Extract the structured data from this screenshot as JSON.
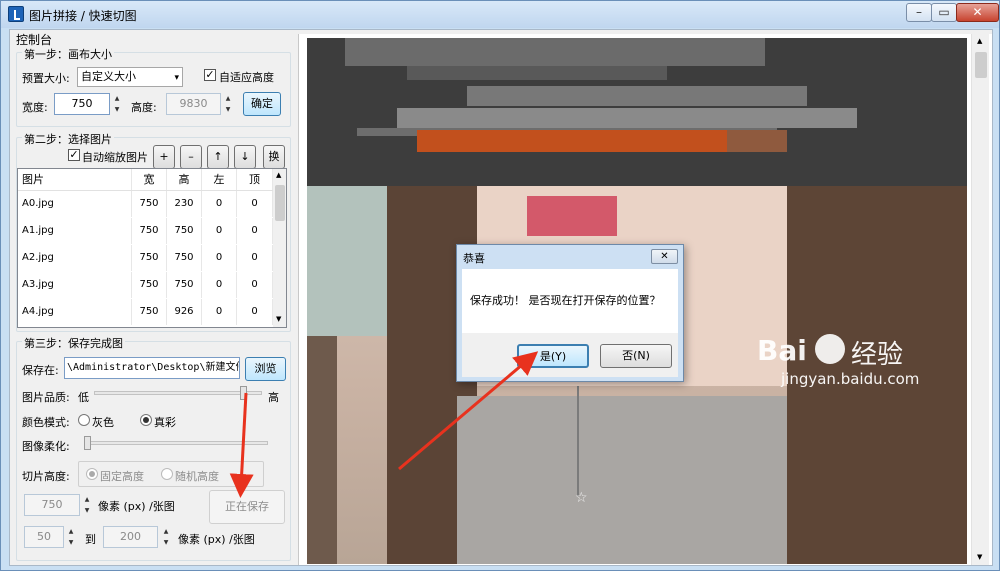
{
  "window": {
    "title": "图片拼接 / 快速切图",
    "min": "–",
    "max": "▭",
    "close": "✕"
  },
  "console_label": "控制台",
  "step1": {
    "title": "第一步：画布大小",
    "preset_label": "预置大小:",
    "preset_value": "自定义大小",
    "adapt_height_label": "自适应高度",
    "adapt_height_checked": true,
    "width_label": "宽度:",
    "width_value": "750",
    "height_label": "高度:",
    "height_value": "9830",
    "confirm": "确定"
  },
  "step2": {
    "title": "第二步：选择图片",
    "auto_scale_label": "自动缩放图片",
    "auto_scale_checked": true,
    "buttons": {
      "add": "+",
      "remove": "–",
      "up": "↑",
      "down": "↓",
      "swap": "换"
    },
    "columns": [
      "图片",
      "宽",
      "高",
      "左",
      "顶"
    ],
    "rows": [
      [
        "A0.jpg",
        "750",
        "230",
        "0",
        "0"
      ],
      [
        "A1.jpg",
        "750",
        "750",
        "0",
        "0"
      ],
      [
        "A2.jpg",
        "750",
        "750",
        "0",
        "0"
      ],
      [
        "A3.jpg",
        "750",
        "750",
        "0",
        "0"
      ],
      [
        "A4.jpg",
        "750",
        "926",
        "0",
        "0"
      ]
    ]
  },
  "step3": {
    "title": "第三步：保存完成图",
    "save_label": "保存在:",
    "save_path": "\\Administrator\\Desktop\\新建文件夹",
    "browse": "浏览",
    "quality_label": "图片品质:",
    "quality_low": "低",
    "quality_high": "高",
    "quality_level": 0.9,
    "color_label": "颜色模式:",
    "color_gray": "灰色",
    "color_true": "真彩",
    "color_selected": "真彩",
    "soften_label": "图像柔化:",
    "soften_level": 0.0,
    "slice_label": "切片高度:",
    "slice_fixed": "固定高度",
    "slice_random": "随机高度",
    "px_value": "750",
    "px_unit": "像素 (px) /张图",
    "saving": "正在保存",
    "range_from": "50",
    "range_to_label": "到",
    "range_to": "200",
    "range_unit": "像素 (px) /张图"
  },
  "dialog": {
    "title": "恭喜",
    "close": "✕",
    "message": "保存成功！ 是否现在打开保存的位置？",
    "yes": "是(Y)",
    "no": "否(N)"
  },
  "watermark": {
    "brand_left": "Bai",
    "brand_right": "经验",
    "url": "jingyan.baidu.com"
  },
  "colors": {
    "titlebar": "#c9dff3",
    "accent": "#3c7fb1",
    "arrow": "#e8321e",
    "dark_banner": "#3d3d3d"
  }
}
